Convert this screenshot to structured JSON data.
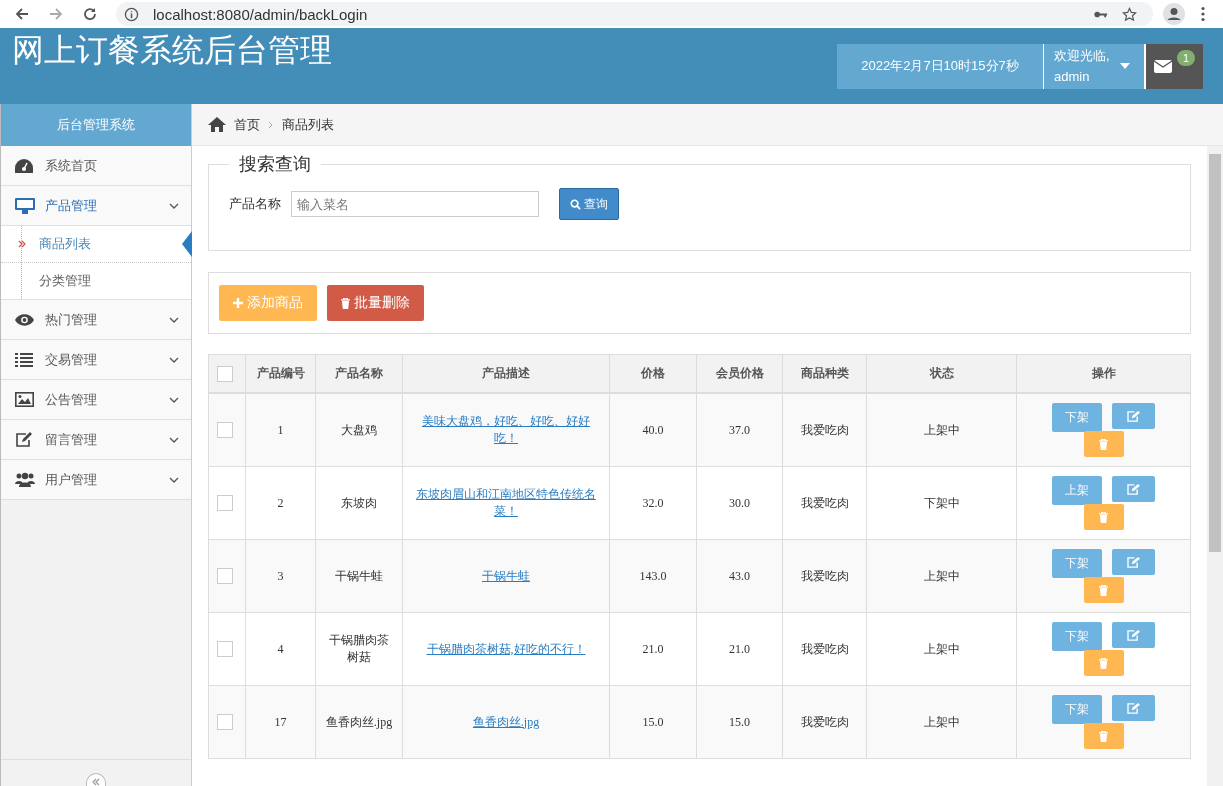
{
  "browser": {
    "url": "localhost:8080/admin/backLogin"
  },
  "header": {
    "title": "网上订餐系统后台管理",
    "datetime": "2022年2月7日10时15分7秒",
    "welcome": "欢迎光临,",
    "user": "admin",
    "message_count": "1"
  },
  "sidebar": {
    "title": "后台管理系统",
    "items": [
      {
        "label": "系统首页"
      },
      {
        "label": "产品管理",
        "expanded": true,
        "children": [
          {
            "label": "商品列表",
            "selected": true
          },
          {
            "label": "分类管理",
            "selected": false
          }
        ]
      },
      {
        "label": "热门管理",
        "expanded": false
      },
      {
        "label": "交易管理",
        "expanded": false
      },
      {
        "label": "公告管理",
        "expanded": false
      },
      {
        "label": "留言管理",
        "expanded": false
      },
      {
        "label": "用户管理",
        "expanded": false
      }
    ]
  },
  "breadcrumb": [
    "首页",
    "商品列表"
  ],
  "search": {
    "legend": "搜索查询",
    "label": "产品名称",
    "placeholder": "输入菜名",
    "button": "查询"
  },
  "actions": [
    {
      "label": "添加商品",
      "kind": "add"
    },
    {
      "label": "批量删除",
      "kind": "delete"
    }
  ],
  "table": {
    "all_checked": false,
    "columns": [
      "产品编号",
      "产品名称",
      "产品描述",
      "价格",
      "会员价格",
      "商品种类",
      "状态",
      "操作"
    ],
    "rows": [
      {
        "checked": false,
        "id": "1",
        "name": "大盘鸡",
        "description": "美味大盘鸡，好吃、好吃、好好吃！",
        "price": "40.0",
        "member_price": "37.0",
        "category": "我爱吃肉",
        "status": "上架中",
        "toggle": "下架"
      },
      {
        "checked": false,
        "id": "2",
        "name": "东坡肉",
        "description": "东坡肉眉山和江南地区特色传统名菜！",
        "price": "32.0",
        "member_price": "30.0",
        "category": "我爱吃肉",
        "status": "下架中",
        "toggle": "上架"
      },
      {
        "checked": false,
        "id": "3",
        "name": "干锅牛蛙",
        "description": "干锅牛蛙",
        "price": "143.0",
        "member_price": "43.0",
        "category": "我爱吃肉",
        "status": "上架中",
        "toggle": "下架"
      },
      {
        "checked": false,
        "id": "4",
        "name": "干锅腊肉茶树菇",
        "description": "干锅腊肉茶树菇,好吃的不行！",
        "price": "21.0",
        "member_price": "21.0",
        "category": "我爱吃肉",
        "status": "上架中",
        "toggle": "下架"
      },
      {
        "checked": false,
        "id": "17",
        "name": "鱼香肉丝.jpg",
        "description": "鱼香肉丝.jpg",
        "price": "15.0",
        "member_price": "15.0",
        "category": "我爱吃肉",
        "status": "上架中",
        "toggle": "下架"
      }
    ]
  }
}
